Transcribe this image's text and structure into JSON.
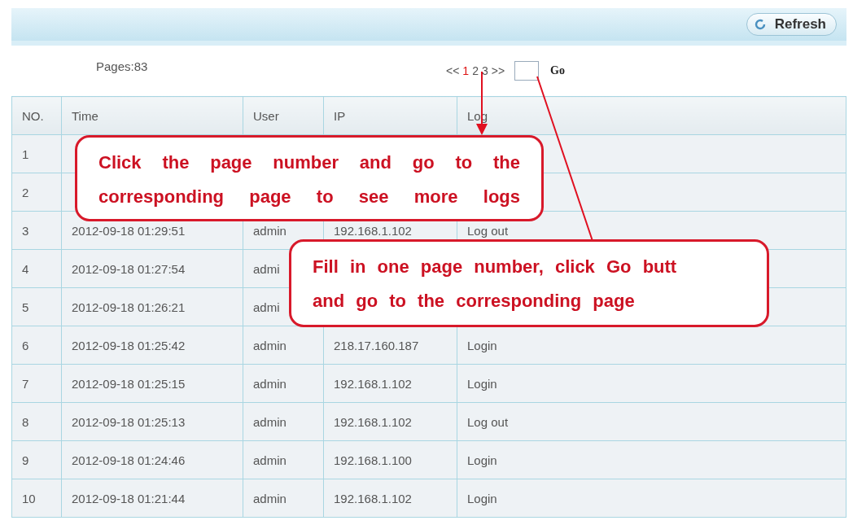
{
  "toolbar": {
    "refresh_button": "Refresh"
  },
  "pagination": {
    "pages_label": "Pages:83",
    "prev": "<<",
    "next": ">>",
    "pages": [
      {
        "label": "1",
        "selected": true
      },
      {
        "label": "2",
        "selected": false
      },
      {
        "label": "3",
        "selected": false
      }
    ],
    "go_button": "Go"
  },
  "table": {
    "columns": [
      "NO.",
      "Time",
      "User",
      "IP",
      "Log"
    ],
    "rows": [
      {
        "no": "1"
      },
      {
        "no": "2"
      },
      {
        "no": "3",
        "time": "2012-09-18 01:29:51",
        "user": "admin",
        "ip": "192.168.1.102",
        "log": "Log out"
      },
      {
        "no": "4",
        "time": "2012-09-18 01:27:54",
        "user": "admi"
      },
      {
        "no": "5",
        "time": "2012-09-18 01:26:21",
        "user": "admi"
      },
      {
        "no": "6",
        "time": "2012-09-18 01:25:42",
        "user": "admin",
        "ip": "218.17.160.187",
        "log": "Login"
      },
      {
        "no": "7",
        "time": "2012-09-18 01:25:15",
        "user": "admin",
        "ip": "192.168.1.102",
        "log": "Login"
      },
      {
        "no": "8",
        "time": "2012-09-18 01:25:13",
        "user": "admin",
        "ip": "192.168.1.102",
        "log": "Log out"
      },
      {
        "no": "9",
        "time": "2012-09-18 01:24:46",
        "user": "admin",
        "ip": "192.168.1.100",
        "log": "Login"
      },
      {
        "no": "10",
        "time": "2012-09-18 01:21:44",
        "user": "admin",
        "ip": "192.168.1.102",
        "log": "Login"
      }
    ]
  },
  "callouts": [
    {
      "lines": [
        "Click the page number and go to the",
        "corresponding page to see more logs"
      ]
    },
    {
      "lines": [
        "Fill in one page number, click Go butt",
        "and go to the corresponding page"
      ]
    }
  ]
}
